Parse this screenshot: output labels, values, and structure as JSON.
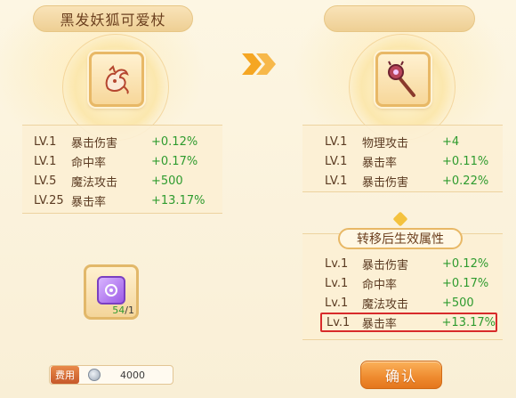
{
  "left": {
    "title": "黑发妖狐可爱杖",
    "item_icon": "fox-charm-icon",
    "stats": [
      {
        "level": "LV.1",
        "name": "暴击伤害",
        "value": "+0.12%"
      },
      {
        "level": "LV.1",
        "name": "命中率",
        "value": "+0.17%"
      },
      {
        "level": "LV.5",
        "name": "魔法攻击",
        "value": "+500"
      },
      {
        "level": "LV.25",
        "name": "暴击率",
        "value": "+13.17%"
      }
    ]
  },
  "right": {
    "item_icon": "magic-staff-icon",
    "stats": [
      {
        "level": "LV.1",
        "name": "物理攻击",
        "value": "+4"
      },
      {
        "level": "LV.1",
        "name": "暴击率",
        "value": "+0.11%"
      },
      {
        "level": "LV.1",
        "name": "暴击伤害",
        "value": "+0.22%"
      }
    ],
    "effect_title": "转移后生效属性",
    "effect_stats": [
      {
        "level": "Lv.1",
        "name": "暴击伤害",
        "value": "+0.12%"
      },
      {
        "level": "Lv.1",
        "name": "命中率",
        "value": "+0.17%"
      },
      {
        "level": "Lv.1",
        "name": "魔法攻击",
        "value": "+500"
      },
      {
        "level": "Lv.1",
        "name": "暴击率",
        "value": "+13.17%"
      }
    ]
  },
  "material": {
    "icon": "purple-gem-icon",
    "have": "54",
    "need": "/1"
  },
  "cost": {
    "label": "费用",
    "icon": "silver-coin-icon",
    "value": "4000"
  },
  "confirm_label": "确认",
  "colors": {
    "stat_value_green": "#2e9b2e",
    "highlight_red": "#d82b2b",
    "button_orange": "#ee8a2e"
  }
}
